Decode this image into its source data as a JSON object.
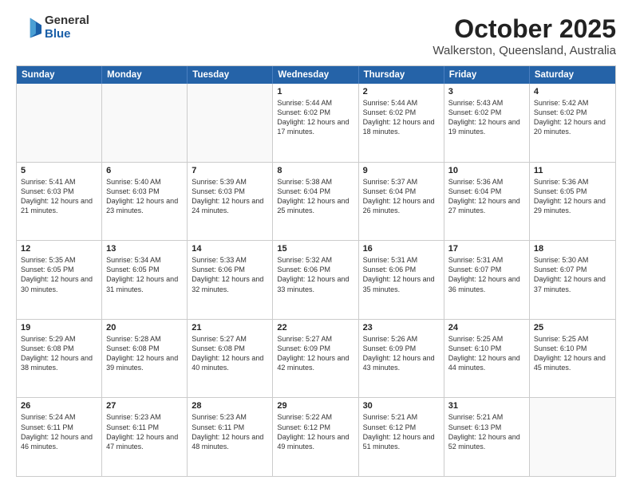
{
  "logo": {
    "general": "General",
    "blue": "Blue"
  },
  "header": {
    "title": "October 2025",
    "subtitle": "Walkerston, Queensland, Australia"
  },
  "weekdays": [
    "Sunday",
    "Monday",
    "Tuesday",
    "Wednesday",
    "Thursday",
    "Friday",
    "Saturday"
  ],
  "weeks": [
    [
      {
        "day": "",
        "text": ""
      },
      {
        "day": "",
        "text": ""
      },
      {
        "day": "",
        "text": ""
      },
      {
        "day": "1",
        "text": "Sunrise: 5:44 AM\nSunset: 6:02 PM\nDaylight: 12 hours and 17 minutes."
      },
      {
        "day": "2",
        "text": "Sunrise: 5:44 AM\nSunset: 6:02 PM\nDaylight: 12 hours and 18 minutes."
      },
      {
        "day": "3",
        "text": "Sunrise: 5:43 AM\nSunset: 6:02 PM\nDaylight: 12 hours and 19 minutes."
      },
      {
        "day": "4",
        "text": "Sunrise: 5:42 AM\nSunset: 6:02 PM\nDaylight: 12 hours and 20 minutes."
      }
    ],
    [
      {
        "day": "5",
        "text": "Sunrise: 5:41 AM\nSunset: 6:03 PM\nDaylight: 12 hours and 21 minutes."
      },
      {
        "day": "6",
        "text": "Sunrise: 5:40 AM\nSunset: 6:03 PM\nDaylight: 12 hours and 23 minutes."
      },
      {
        "day": "7",
        "text": "Sunrise: 5:39 AM\nSunset: 6:03 PM\nDaylight: 12 hours and 24 minutes."
      },
      {
        "day": "8",
        "text": "Sunrise: 5:38 AM\nSunset: 6:04 PM\nDaylight: 12 hours and 25 minutes."
      },
      {
        "day": "9",
        "text": "Sunrise: 5:37 AM\nSunset: 6:04 PM\nDaylight: 12 hours and 26 minutes."
      },
      {
        "day": "10",
        "text": "Sunrise: 5:36 AM\nSunset: 6:04 PM\nDaylight: 12 hours and 27 minutes."
      },
      {
        "day": "11",
        "text": "Sunrise: 5:36 AM\nSunset: 6:05 PM\nDaylight: 12 hours and 29 minutes."
      }
    ],
    [
      {
        "day": "12",
        "text": "Sunrise: 5:35 AM\nSunset: 6:05 PM\nDaylight: 12 hours and 30 minutes."
      },
      {
        "day": "13",
        "text": "Sunrise: 5:34 AM\nSunset: 6:05 PM\nDaylight: 12 hours and 31 minutes."
      },
      {
        "day": "14",
        "text": "Sunrise: 5:33 AM\nSunset: 6:06 PM\nDaylight: 12 hours and 32 minutes."
      },
      {
        "day": "15",
        "text": "Sunrise: 5:32 AM\nSunset: 6:06 PM\nDaylight: 12 hours and 33 minutes."
      },
      {
        "day": "16",
        "text": "Sunrise: 5:31 AM\nSunset: 6:06 PM\nDaylight: 12 hours and 35 minutes."
      },
      {
        "day": "17",
        "text": "Sunrise: 5:31 AM\nSunset: 6:07 PM\nDaylight: 12 hours and 36 minutes."
      },
      {
        "day": "18",
        "text": "Sunrise: 5:30 AM\nSunset: 6:07 PM\nDaylight: 12 hours and 37 minutes."
      }
    ],
    [
      {
        "day": "19",
        "text": "Sunrise: 5:29 AM\nSunset: 6:08 PM\nDaylight: 12 hours and 38 minutes."
      },
      {
        "day": "20",
        "text": "Sunrise: 5:28 AM\nSunset: 6:08 PM\nDaylight: 12 hours and 39 minutes."
      },
      {
        "day": "21",
        "text": "Sunrise: 5:27 AM\nSunset: 6:08 PM\nDaylight: 12 hours and 40 minutes."
      },
      {
        "day": "22",
        "text": "Sunrise: 5:27 AM\nSunset: 6:09 PM\nDaylight: 12 hours and 42 minutes."
      },
      {
        "day": "23",
        "text": "Sunrise: 5:26 AM\nSunset: 6:09 PM\nDaylight: 12 hours and 43 minutes."
      },
      {
        "day": "24",
        "text": "Sunrise: 5:25 AM\nSunset: 6:10 PM\nDaylight: 12 hours and 44 minutes."
      },
      {
        "day": "25",
        "text": "Sunrise: 5:25 AM\nSunset: 6:10 PM\nDaylight: 12 hours and 45 minutes."
      }
    ],
    [
      {
        "day": "26",
        "text": "Sunrise: 5:24 AM\nSunset: 6:11 PM\nDaylight: 12 hours and 46 minutes."
      },
      {
        "day": "27",
        "text": "Sunrise: 5:23 AM\nSunset: 6:11 PM\nDaylight: 12 hours and 47 minutes."
      },
      {
        "day": "28",
        "text": "Sunrise: 5:23 AM\nSunset: 6:11 PM\nDaylight: 12 hours and 48 minutes."
      },
      {
        "day": "29",
        "text": "Sunrise: 5:22 AM\nSunset: 6:12 PM\nDaylight: 12 hours and 49 minutes."
      },
      {
        "day": "30",
        "text": "Sunrise: 5:21 AM\nSunset: 6:12 PM\nDaylight: 12 hours and 51 minutes."
      },
      {
        "day": "31",
        "text": "Sunrise: 5:21 AM\nSunset: 6:13 PM\nDaylight: 12 hours and 52 minutes."
      },
      {
        "day": "",
        "text": ""
      }
    ]
  ]
}
